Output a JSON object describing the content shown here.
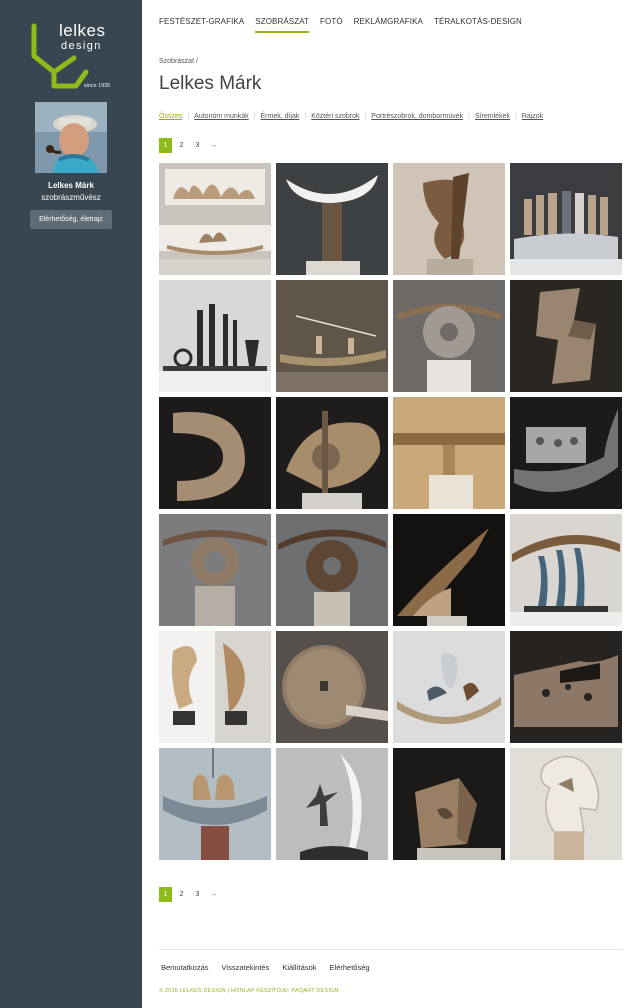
{
  "brand": {
    "line1": "lelkes",
    "line2": "design",
    "since": "since 1935",
    "accent": "#8dbb1a"
  },
  "profile": {
    "name": "Lelkes Márk",
    "role": "szobrászművész",
    "contact_label": "Elérhetőség, életrajz"
  },
  "topnav": [
    {
      "label": "FESTÉSZET-GRAFIKA"
    },
    {
      "label": "SZOBRÁSZAT",
      "active": true
    },
    {
      "label": "FOTÓ"
    },
    {
      "label": "REKLÁMGRAFIKA"
    },
    {
      "label": "TÉRALKOTÁS-DESIGN"
    }
  ],
  "breadcrumb": "Szobrászat /",
  "title": "Lelkes Márk",
  "subnav": [
    {
      "label": "Összes",
      "active": true
    },
    {
      "label": "Autonóm munkák"
    },
    {
      "label": "Érmek, díjak"
    },
    {
      "label": "Köztéri szobrok"
    },
    {
      "label": "Portrészobrok, dombormüvek"
    },
    {
      "label": "Síremlékek"
    },
    {
      "label": "Rajzok"
    }
  ],
  "pager": [
    "1",
    "2",
    "3",
    "→"
  ],
  "footer": {
    "links": [
      "Bemutatkozás",
      "Visszatekintés",
      "Kiállítások",
      "Elérhetőség"
    ],
    "copyright": "© 2016 LELKES DESIGN | HONLAP KÉSZÍTŐJE: PAQART DESIGN"
  },
  "gallery": {
    "items": [
      {
        "icon": "sculpture-group-thumbnail",
        "bg": "#c9c4bd"
      },
      {
        "icon": "white-crescent-sculpture-thumbnail",
        "bg": "#3e4143"
      },
      {
        "icon": "wooden-abstract-sculpture-thumbnail",
        "bg": "#cfc4b6"
      },
      {
        "icon": "figures-group-sculpture-thumbnail",
        "bg": "#3a3c3f"
      },
      {
        "icon": "metal-figures-sculpture-thumbnail",
        "bg": "#d8d8d6"
      },
      {
        "icon": "boat-figures-sculpture-thumbnail",
        "bg": "#5f5548"
      },
      {
        "icon": "stone-disc-sculpture-thumbnail",
        "bg": "#6d6a68"
      },
      {
        "icon": "angular-wood-sculpture-thumbnail",
        "bg": "#2a2622"
      },
      {
        "icon": "curved-stone-sculpture-thumbnail",
        "bg": "#1d1b1a"
      },
      {
        "icon": "eye-shaped-sculpture-thumbnail",
        "bg": "#1f1d1c"
      },
      {
        "icon": "beam-sculpture-thumbnail",
        "bg": "#c9a97a"
      },
      {
        "icon": "glass-boat-sculpture-thumbnail",
        "bg": "#1b1b1c"
      },
      {
        "icon": "ring-arch-sculpture-thumbnail",
        "bg": "#7b7c7e"
      },
      {
        "icon": "dark-ring-arch-sculpture-thumbnail",
        "bg": "#6e6f71"
      },
      {
        "icon": "folded-plane-sculpture-thumbnail",
        "bg": "#141210"
      },
      {
        "icon": "arch-figures-sculpture-thumbnail",
        "bg": "#d9d6d2"
      },
      {
        "icon": "twin-abstract-sculpture-thumbnail",
        "bg": "#d8d4cf"
      },
      {
        "icon": "millstone-sculpture-thumbnail",
        "bg": "#55504b"
      },
      {
        "icon": "boat-figurines-sculpture-thumbnail",
        "bg": "#dcdcdc"
      },
      {
        "icon": "perforated-plate-sculpture-thumbnail",
        "bg": "#262321"
      },
      {
        "icon": "ship-cups-sculpture-thumbnail",
        "bg": "#b3bdc4"
      },
      {
        "icon": "sail-figure-sculpture-thumbnail",
        "bg": "#bdbdbb"
      },
      {
        "icon": "cube-shell-sculpture-thumbnail",
        "bg": "#1c1a19"
      },
      {
        "icon": "horse-head-sculpture-thumbnail",
        "bg": "#e1ddd7"
      }
    ]
  }
}
